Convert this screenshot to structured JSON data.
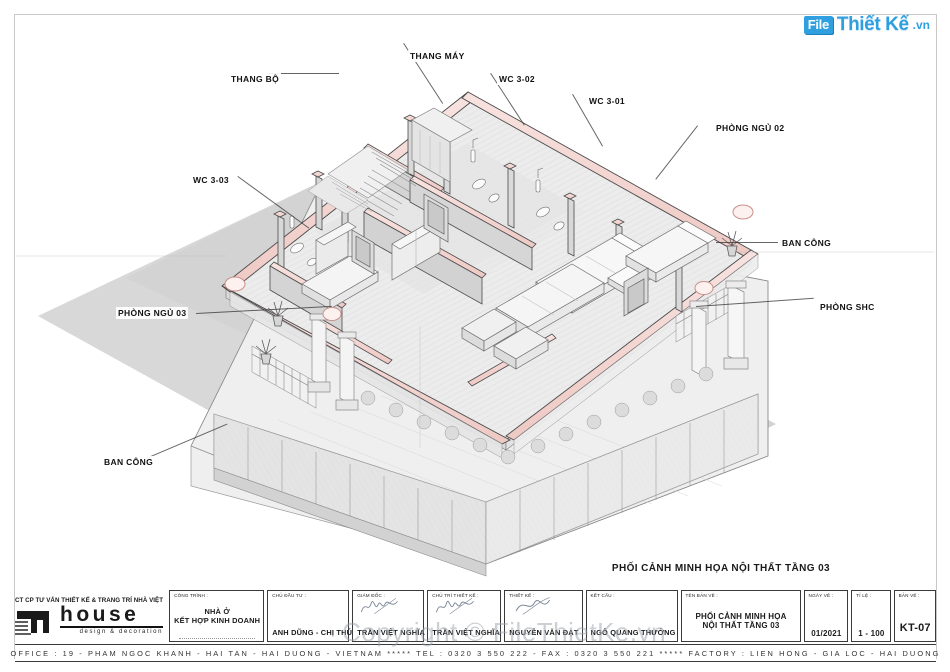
{
  "brand": {
    "file": "File",
    "name": "Thiết Kế",
    "tld": ".vn"
  },
  "watermark": {
    "text": "Copyright © FileThietKe.vn"
  },
  "drawing": {
    "caption": "PHỐI CẢNH MINH HỌA NỘI THẤT TẦNG 03",
    "annotations": [
      {
        "label": "THANG MÁY"
      },
      {
        "label": "THANG BỘ"
      },
      {
        "label": "WC 3-02"
      },
      {
        "label": "WC 3-01"
      },
      {
        "label": "PHÒNG NGỦ 02"
      },
      {
        "label": "WC 3-03"
      },
      {
        "label": "BAN CÔNG"
      },
      {
        "label": "PHÒNG NGỦ 03"
      },
      {
        "label": "PHÒNG SHC"
      },
      {
        "label": "BAN CÔNG"
      }
    ]
  },
  "titleblock": {
    "company": {
      "line": "CT CP TƯ VẤN THIẾT KẾ & TRANG TRÍ NHÀ VIỆT",
      "word": "house",
      "sub": "design & decoration"
    },
    "fields": [
      {
        "caption": "CÔNG TRÌNH :",
        "value": "NHÀ Ở\nKẾT HỢP KINH DOANH"
      },
      {
        "caption": "CHỦ ĐẦU TƯ :",
        "value": "ANH DŨNG - CHỊ THÚY"
      },
      {
        "caption": "GIÁM ĐỐC :",
        "value": "TRẦN VIỆT NGHĨA"
      },
      {
        "caption": "CHỦ TRÌ THIẾT KẾ :",
        "value": "TRẦN VIỆT NGHĨA"
      },
      {
        "caption": "THIẾT KẾ :",
        "value": "NGUYỄN VĂN ĐẠT"
      },
      {
        "caption": "KẾT CẤU :",
        "value": "NGÔ QUANG THƯỞNG"
      },
      {
        "caption": "TÊN BẢN VẼ :",
        "value": "PHỐI CẢNH MINH HỌA\nNỘI THẤT TẦNG 03"
      },
      {
        "caption": "NGÀY VẼ :",
        "value": "01/2021"
      },
      {
        "caption": "TỈ LỆ :",
        "value": "1 - 100"
      },
      {
        "caption": "BẢN VẼ :",
        "value": "KT-07"
      }
    ]
  },
  "footer": {
    "text": "OFFICE : 19 - PHAM NGOC KHANH  -  HAI TAN  -  HAI DUONG  -  VIETNAM  *****  TEL : 0320 3 550 222 - FAX : 0320 3 550 221  *****  FACTORY : LIEN HONG  -  GIA LOC - HAI DUONG"
  },
  "colors": {
    "wall": "#f4d9d6",
    "wall_stroke": "#3a3a3a",
    "floor": "#e9e9e9",
    "shadow": "#d4d4d4",
    "accent": "#2f9fe0"
  }
}
